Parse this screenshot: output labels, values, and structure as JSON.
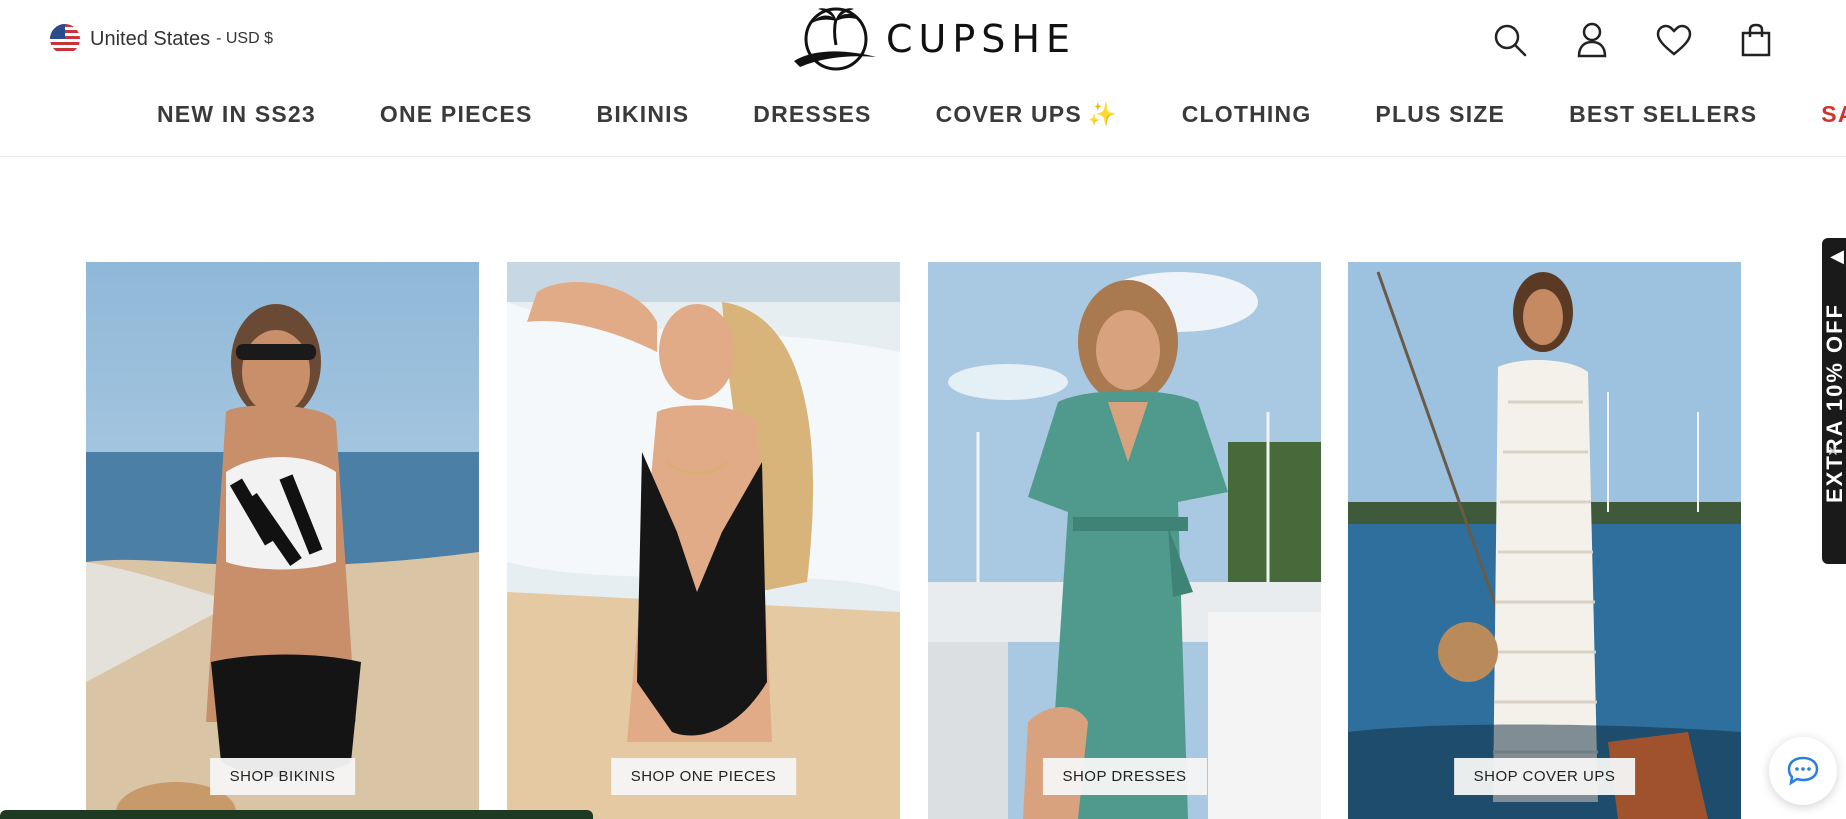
{
  "locale": {
    "country": "United States",
    "currency": "- USD $"
  },
  "logo": {
    "text": "CUPSHE"
  },
  "header_icons": [
    "search-icon",
    "account-icon",
    "wishlist-heart-icon",
    "cart-bag-icon"
  ],
  "nav": {
    "items": [
      {
        "label": "NEW IN SS23"
      },
      {
        "label": "ONE PIECES"
      },
      {
        "label": "BIKINIS"
      },
      {
        "label": "DRESSES"
      },
      {
        "label": "COVER UPS",
        "extra": "✨"
      },
      {
        "label": "CLOTHING"
      },
      {
        "label": "PLUS SIZE"
      },
      {
        "label": "BEST SELLERS"
      },
      {
        "label": "SALE"
      }
    ]
  },
  "tiles": [
    {
      "cta": "SHOP BIKINIS"
    },
    {
      "cta": "SHOP ONE PIECES"
    },
    {
      "cta": "SHOP DRESSES"
    },
    {
      "cta": "SHOP COVER UPS"
    }
  ],
  "promo": {
    "text": "EXTRA 10% OFF"
  },
  "colors": {
    "sale": "#d0342c",
    "promo_bg": "#1a1a1a",
    "dress": "#4f9a8c",
    "sky": "#9dc2df",
    "sea": "#2f6f9d"
  }
}
